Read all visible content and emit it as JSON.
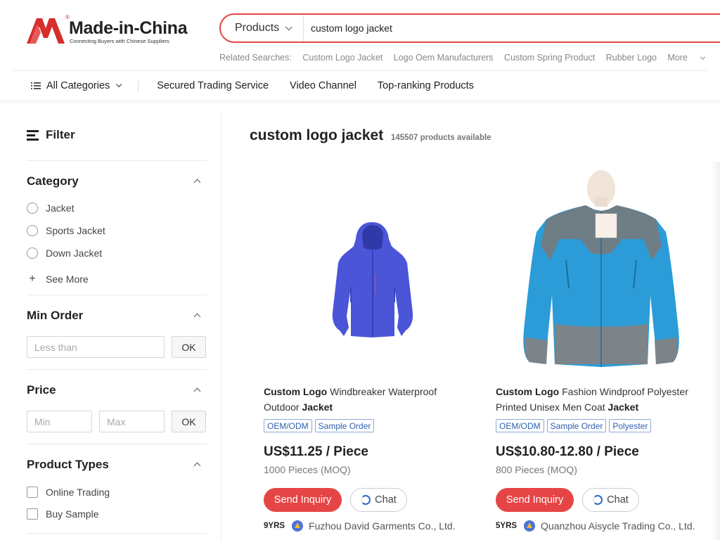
{
  "brand": {
    "name": "Made-in-China",
    "registered": "®",
    "tagline": "Connecting Buyers with Chinese Suppliers",
    "color": "#d62d2d"
  },
  "search": {
    "category": "Products",
    "query": "custom logo jacket",
    "accent_color": "#e64545"
  },
  "related": {
    "label": "Related Searches:",
    "items": [
      "Custom Logo Jacket",
      "Logo Oem Manufacturers",
      "Custom Spring Product",
      "Rubber Logo"
    ],
    "more": "More"
  },
  "nav": {
    "all_categories": "All Categories",
    "items": [
      "Secured Trading Service",
      "Video Channel",
      "Top-ranking Products"
    ]
  },
  "filter": {
    "title": "Filter",
    "category": {
      "title": "Category",
      "options": [
        "Jacket",
        "Sports Jacket",
        "Down Jacket"
      ],
      "see_more": "See More"
    },
    "min_order": {
      "title": "Min Order",
      "placeholder": "Less than",
      "ok": "OK"
    },
    "price": {
      "title": "Price",
      "min_placeholder": "Min",
      "max_placeholder": "Max",
      "ok": "OK"
    },
    "product_types": {
      "title": "Product Types",
      "options": [
        "Online Trading",
        "Buy Sample"
      ]
    }
  },
  "results": {
    "title": "custom logo jacket",
    "count": "145507",
    "count_label": "products available"
  },
  "products": [
    {
      "title_bold_1": "Custom Logo",
      "title_text": " Windbreaker Waterproof Outdoor ",
      "title_bold_2": "Jacket",
      "tags": [
        "OEM/ODM",
        "Sample Order"
      ],
      "price": "US$11.25 / Piece",
      "moq": "1000 Pieces (MOQ)",
      "inquiry": "Send Inquiry",
      "chat": "Chat",
      "years": "9YRS",
      "supplier": "Fuzhou David Garments Co., Ltd."
    },
    {
      "title_bold_1": "Custom Logo",
      "title_text": " Fashion Windproof Polyester Printed Unisex Men Coat ",
      "title_bold_2": "Jacket",
      "tags": [
        "OEM/ODM",
        "Sample Order",
        "Polyester"
      ],
      "price": "US$10.80-12.80 / Piece",
      "moq": "800 Pieces (MOQ)",
      "inquiry": "Send Inquiry",
      "chat": "Chat",
      "years": "5YRS",
      "supplier": "Quanzhou Aisycle Trading Co., Ltd."
    }
  ]
}
